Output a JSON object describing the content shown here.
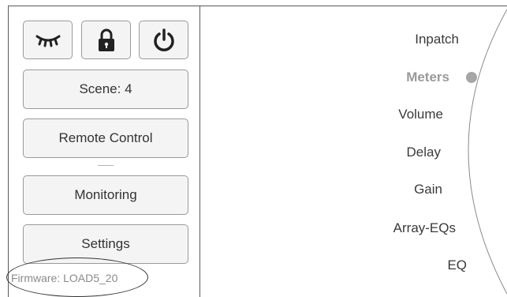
{
  "toolbar": {
    "icons": [
      "eye-closed-icon",
      "lock-icon",
      "power-icon"
    ]
  },
  "sidebar": {
    "scene_label": "Scene: 4",
    "remote_label": "Remote Control",
    "monitoring_label": "Monitoring",
    "settings_label": "Settings",
    "firmware": "Firmware: LOAD5_20"
  },
  "nav": {
    "items": [
      "Inpatch",
      "Meters",
      "Volume",
      "Delay",
      "Gain",
      "Array-EQs",
      "EQ"
    ],
    "active": "Meters"
  },
  "colors": {
    "border": "#5a5a5a",
    "button_bg": "#f4f4f4",
    "active_text": "#9a9a9a",
    "indicator": "#a6a6a6"
  }
}
